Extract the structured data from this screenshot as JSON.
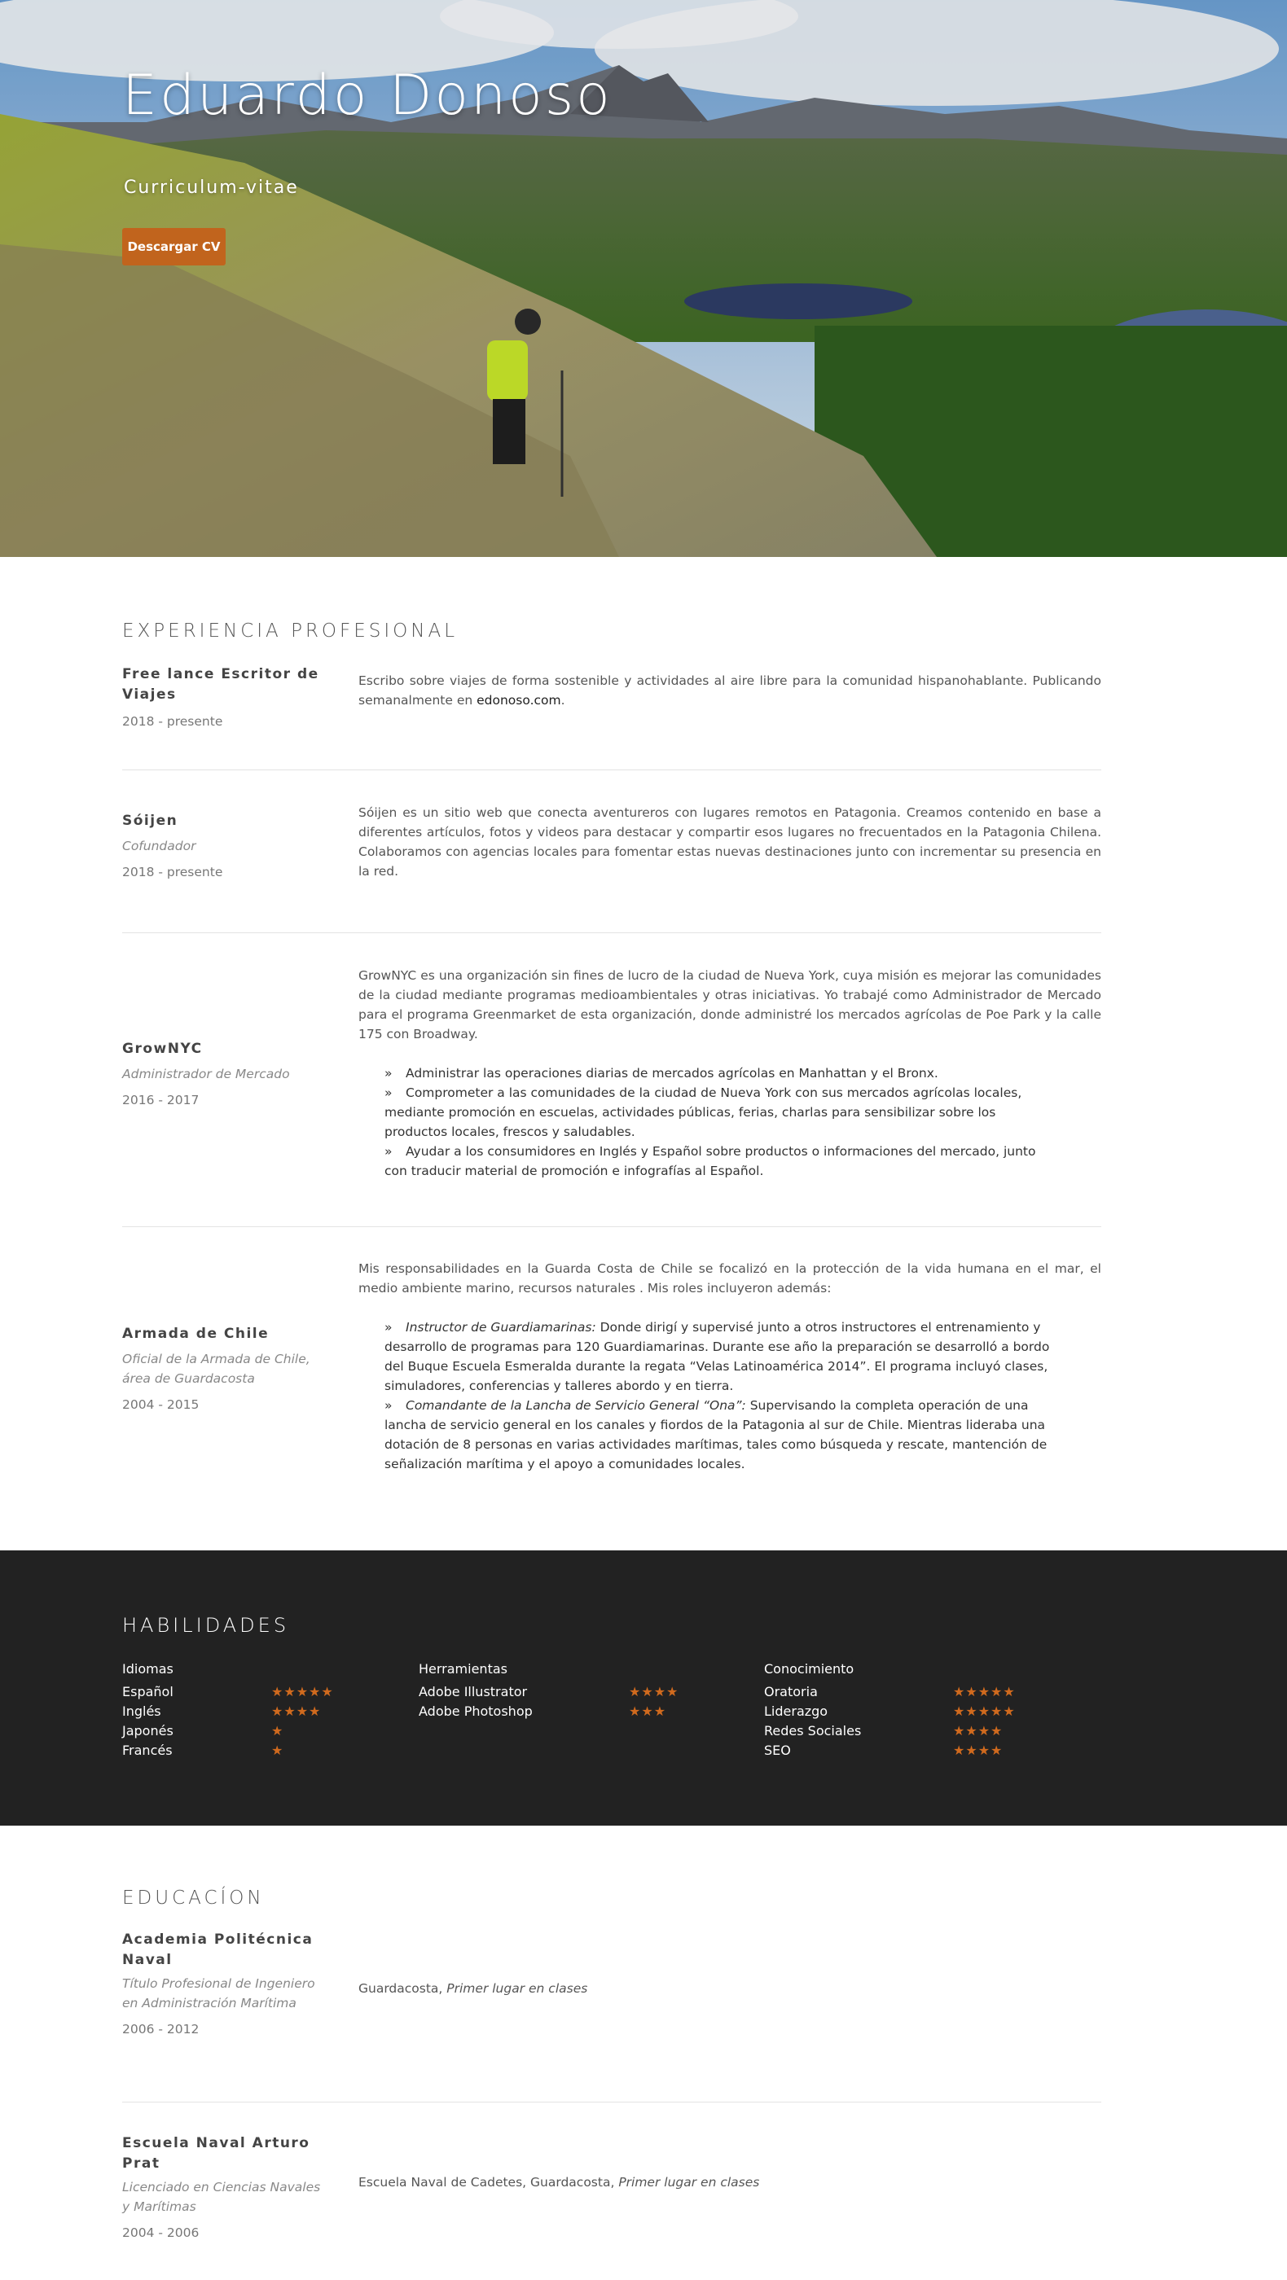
{
  "hero": {
    "name": "Eduardo Donoso",
    "subtitle": "Curriculum-vitae",
    "download_button": "Descargar CV"
  },
  "experience": {
    "title": "EXPERIENCIA PROFESIONAL",
    "entries": [
      {
        "org": "Free lance Escritor de Viajes",
        "role": "",
        "dates": "2018 - presente",
        "text_before_link": "Escribo sobre viajes de forma sostenible y actividades al aire libre para la comunidad hispanohablante. Publicando semanalmente en ",
        "link": "edonoso.com",
        "text_after_link": "."
      },
      {
        "org": "Sóijen",
        "role": "Cofundador",
        "dates": "2018 - presente",
        "text": "Sóijen es un sitio web que conecta aventureros con lugares remotos en Patagonia. Creamos contenido en base a diferentes artículos, fotos y videos para destacar y compartir esos lugares no frecuentados en la Patagonia Chilena. Colaboramos con agencias locales para fomentar estas nuevas destinaciones junto con incrementar su presencia en la red."
      },
      {
        "org": "GrowNYC",
        "role": "Administrador de Mercado",
        "dates": "2016 - 2017",
        "text": "GrowNYC es una organización sin fines de lucro de la ciudad de Nueva York, cuya misión es mejorar las comunidades de la ciudad mediante programas medioambientales y otras iniciativas. Yo trabajé como Administrador de Mercado para el programa Greenmarket de esta organización, donde administré los mercados agrícolas de Poe Park y la calle 175 con Broadway.",
        "bullets": [
          "Administrar las operaciones diarias de mercados agrícolas en Manhattan y el Bronx.",
          "Comprometer a las comunidades de la ciudad de Nueva York con sus mercados agrícolas locales, mediante promoción en escuelas, actividades públicas, ferias, charlas para sensibilizar sobre los productos locales, frescos y saludables.",
          "Ayudar a los consumidores en Inglés y Español sobre productos o informaciones del mercado, junto con traducir material de promoción e infografías al Español."
        ]
      },
      {
        "org": "Armada de Chile",
        "role": "Oficial de la Armada de Chile, área de Guardacosta",
        "dates": "2004 - 2015",
        "text": "Mis responsabilidades en la Guarda Costa de Chile se focalizó en la protección de la vida humana en el mar, el medio ambiente marino, recursos naturales . Mis roles incluyeron además:",
        "bullets": [
          {
            "em": "Instructor de Guardiamarinas:",
            "text": " Donde dirigí y supervisé junto a otros instructores el entrenamiento y desarrollo de programas para 120 Guardiamarinas. Durante ese año la preparación se desarrolló a bordo del Buque Escuela Esmeralda durante la regata “Velas Latinoamérica 2014”. El programa incluyó clases, simuladores, conferencias y talleres abordo y en tierra."
          },
          {
            "em": "Comandante de la Lancha de Servicio General “Ona”:",
            "text": " Supervisando la completa operación de una lancha de servicio general en los canales y fiordos de la Patagonia al sur de Chile. Mientras lideraba una dotación de 8 personas en varias actividades marítimas, tales como búsqueda y rescate, mantención de señalización marítima y el apoyo a comunidades locales."
          }
        ]
      }
    ]
  },
  "skills": {
    "title": "HABILIDADES",
    "star_color": "#d06a1e",
    "columns": [
      {
        "heading": "Idiomas",
        "items": [
          {
            "name": "Español",
            "stars": 5
          },
          {
            "name": "Inglés",
            "stars": 4
          },
          {
            "name": "Japonés",
            "stars": 1
          },
          {
            "name": "Francés",
            "stars": 1
          }
        ]
      },
      {
        "heading": "Herramientas",
        "items": [
          {
            "name": "Adobe Illustrator",
            "stars": 4
          },
          {
            "name": "Adobe Photoshop",
            "stars": 3
          }
        ]
      },
      {
        "heading": "Conocimiento",
        "items": [
          {
            "name": "Oratoria",
            "stars": 5
          },
          {
            "name": "Liderazgo",
            "stars": 5
          },
          {
            "name": "Redes Sociales",
            "stars": 4
          },
          {
            "name": "SEO",
            "stars": 4
          }
        ]
      }
    ]
  },
  "education": {
    "title": "EDUCACÍON",
    "entries": [
      {
        "org": "Academia Politécnica Naval",
        "role": "Título Profesional de Ingeniero en Administración Marítima",
        "dates": "2006 - 2012",
        "text": "Guardacosta, ",
        "text_em": "Primer lugar en clases"
      },
      {
        "org": "Escuela Naval Arturo Prat",
        "role": "Licenciado en Ciencias Navales y Marítimas",
        "dates": "2004 - 2006",
        "text": "Escuela Naval de Cadetes, Guardacosta, ",
        "text_em": "Primer lugar en clases"
      }
    ]
  }
}
